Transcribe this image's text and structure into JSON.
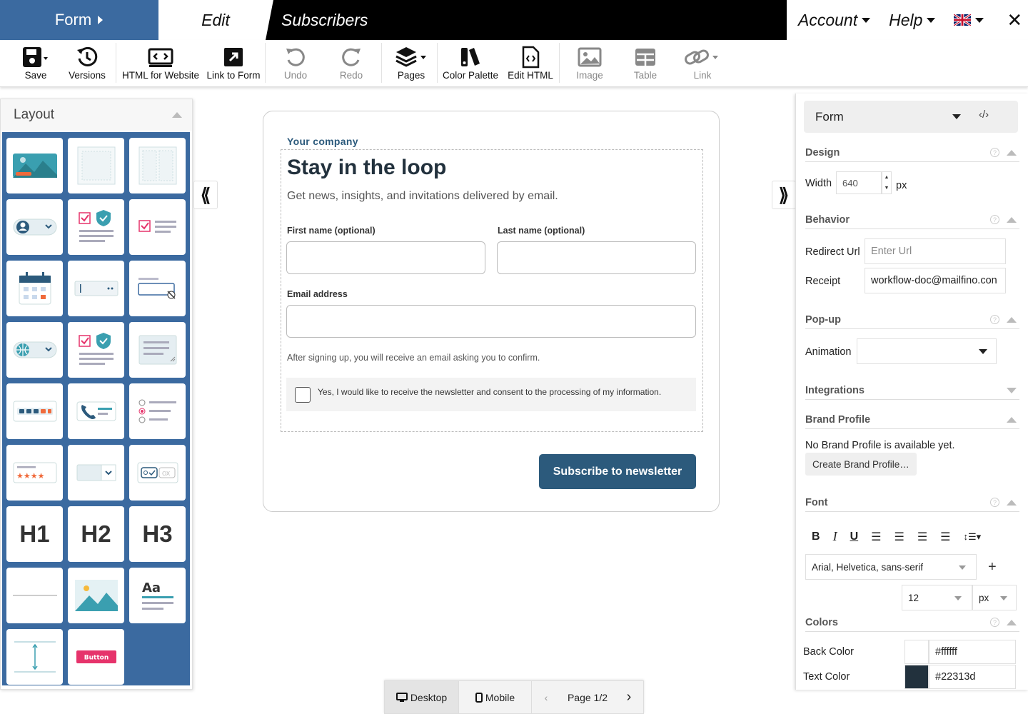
{
  "topbar": {
    "form_tab": "Form",
    "edit_tab": "Edit",
    "subscribers_tab": "Subscribers",
    "account": "Account",
    "help": "Help",
    "language_icon": "uk-flag-icon",
    "close_icon": "close-icon",
    "brand_color": "#3b6aa0"
  },
  "toolbar": {
    "save": "Save",
    "versions": "Versions",
    "html_for_website": "HTML for Website",
    "link_to_form": "Link to Form",
    "undo": "Undo",
    "redo": "Redo",
    "pages": "Pages",
    "color_palette": "Color Palette",
    "edit_html": "Edit HTML",
    "image": "Image",
    "table": "Table",
    "link": "Link"
  },
  "layout_panel": {
    "title": "Layout",
    "tiles": [
      "image-block",
      "single-column",
      "two-column",
      "user-select",
      "consent-checkbox",
      "checkbox",
      "date-picker",
      "password-input",
      "hidden-password",
      "country-select",
      "consent-checkbox-2",
      "textarea",
      "code-input",
      "phone-input",
      "radio-group",
      "rating",
      "dropdown",
      "toggle",
      "H1",
      "H2",
      "H3",
      "divider",
      "image",
      "text-block",
      "spacer",
      "button"
    ],
    "button_tile_label": "Button"
  },
  "form": {
    "company": "Your company",
    "title": "Stay in the loop",
    "subtitle": "Get news, insights, and invitations delivered by email.",
    "first_name_label": "First name (optional)",
    "last_name_label": "Last name (optional)",
    "email_label": "Email address",
    "confirm_note": "After signing up, you will receive an email asking you to confirm.",
    "consent_text": "Yes, I would like to receive the newsletter and consent to the processing of my information.",
    "subscribe_button": "Subscribe to newsletter",
    "accent_color": "#2c5a7c"
  },
  "properties": {
    "selected": "Form",
    "design": {
      "heading": "Design",
      "width_label": "Width",
      "width_value": "640",
      "unit": "px"
    },
    "behavior": {
      "heading": "Behavior",
      "redirect_label": "Redirect Url",
      "redirect_placeholder": "Enter Url",
      "receipt_label": "Receipt",
      "receipt_value": "workflow-doc@mailfino.con"
    },
    "popup": {
      "heading": "Pop-up",
      "animation_label": "Animation",
      "animation_value": ""
    },
    "integrations": {
      "heading": "Integrations"
    },
    "brand_profile": {
      "heading": "Brand Profile",
      "empty_text": "No Brand Profile is available yet.",
      "create_button": "Create Brand Profile…"
    },
    "font": {
      "heading": "Font",
      "family": "Arial, Helvetica, sans-serif",
      "size": "12",
      "unit": "px"
    },
    "colors": {
      "heading": "Colors",
      "back_label": "Back Color",
      "back_value": "#ffffff",
      "text_label": "Text Color",
      "text_value": "#22313d"
    }
  },
  "bottom_bar": {
    "desktop": "Desktop",
    "mobile": "Mobile",
    "page": "Page 1/2"
  }
}
